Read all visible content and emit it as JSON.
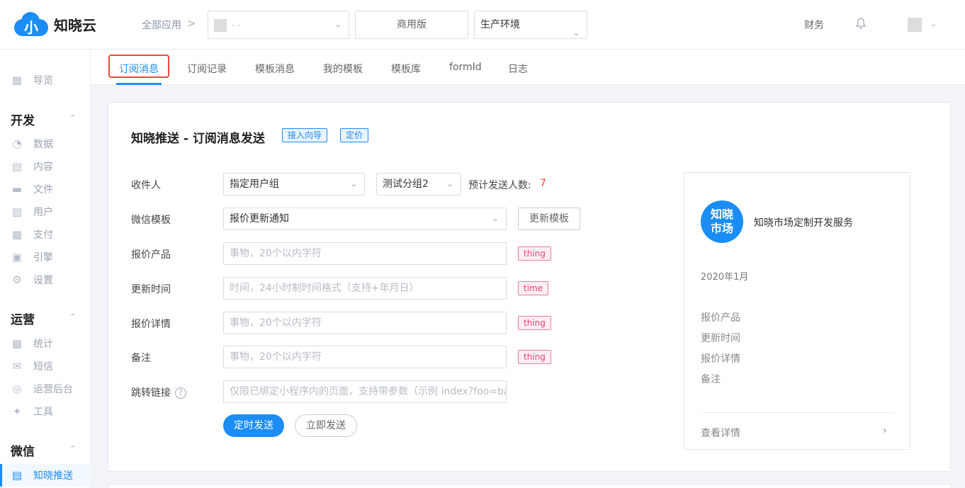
{
  "header": {
    "logo_mark": "小",
    "brand": "知晓云",
    "breadcrumb": "全部应用",
    "breadcrumb_sep": ">",
    "app_select_dots": ". .",
    "version": "商用版",
    "environment": "生产环境",
    "finance": "财务"
  },
  "sidebar": {
    "overview": "导览",
    "groups": [
      {
        "title": "开发",
        "items": [
          "数据",
          "内容",
          "文件",
          "用户",
          "支付",
          "引擎",
          "设置"
        ]
      },
      {
        "title": "运营",
        "items": [
          "统计",
          "短信",
          "运营后台",
          "工具"
        ]
      },
      {
        "title": "微信",
        "items": [
          "知晓推送"
        ]
      }
    ]
  },
  "tabs": [
    "订阅消息",
    "订阅记录",
    "模板消息",
    "我的模板",
    "模板库",
    "formId",
    "日志"
  ],
  "page": {
    "title": "知晓推送 - 订阅消息发送",
    "guide_tag": "接入向导",
    "price_tag": "定价"
  },
  "form": {
    "recipient_label": "收件人",
    "recipient_value": "指定用户组",
    "group_value": "测试分组2",
    "count_label": "预计发送人数:",
    "count_value": "7",
    "template_label": "微信模板",
    "template_value": "报价更新通知",
    "update_template_btn": "更新模板",
    "fields": [
      {
        "label": "报价产品",
        "placeholder": "事物，20个以内字符",
        "tag": "thing"
      },
      {
        "label": "更新时间",
        "placeholder": "时间，24小时制时间格式（支持+年月日）",
        "tag": "time"
      },
      {
        "label": "报价详情",
        "placeholder": "事物，20个以内字符",
        "tag": "thing"
      },
      {
        "label": "备注",
        "placeholder": "事物，20个以内字符",
        "tag": "thing"
      }
    ],
    "link_label": "跳转链接",
    "link_placeholder": "仅限已绑定小程序内的页面，支持带参数（示例 index?foo=ba",
    "help_glyph": "?",
    "scheduled_btn": "定时发送",
    "send_now_btn": "立即发送"
  },
  "preview": {
    "logo_line1": "知晓",
    "logo_line2": "市场",
    "name": "知晓市场定制开发服务",
    "date": "2020年1月",
    "fields": [
      "报价产品",
      "更新时间",
      "报价详情",
      "备注"
    ],
    "view_details": "查看详情"
  },
  "colors": {
    "primary": "#1b8df5",
    "highlight_box": "#e64a3b",
    "tag_pink": "#e0457b",
    "count": "#e64a3b"
  },
  "icons": [
    "bell-icon",
    "chevron-down-icon",
    "help-icon",
    "chevron-right-icon",
    "grid-icon",
    "pie-icon",
    "document-icon",
    "folder-icon",
    "user-icon",
    "wallet-icon",
    "chart-icon",
    "gear-icon",
    "bar-chart-icon",
    "mail-icon",
    "dashboard-icon",
    "wrench-icon",
    "layout-icon"
  ]
}
